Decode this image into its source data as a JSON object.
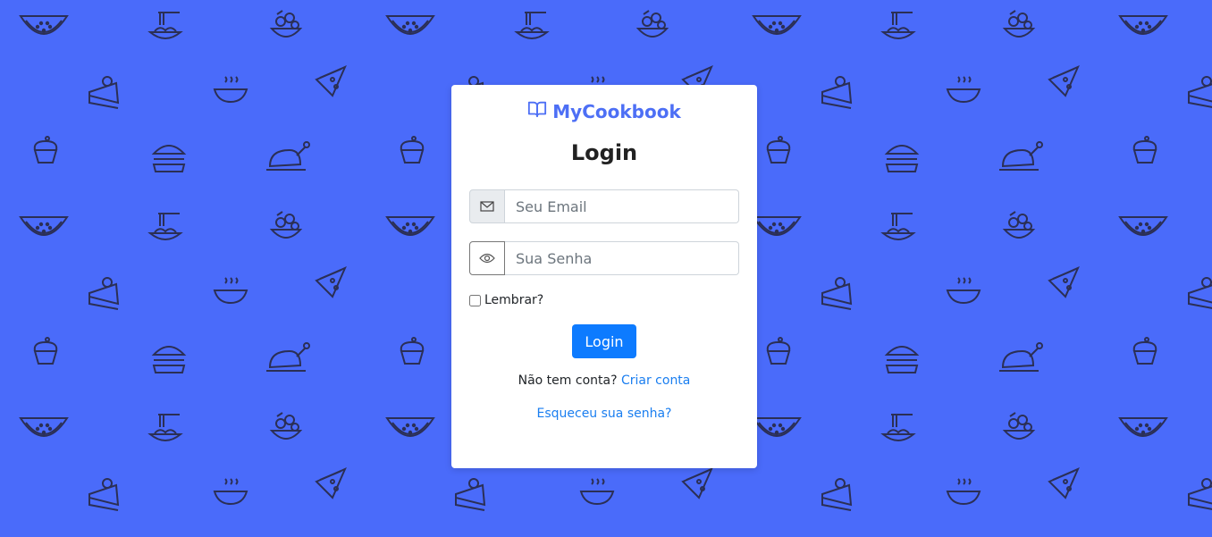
{
  "brand": {
    "name": "MyCookbook",
    "icon": "open-book-icon",
    "color": "#4d6ff5"
  },
  "form": {
    "title": "Login",
    "email_placeholder": "Seu Email",
    "email_icon": "envelope-icon",
    "password_placeholder": "Sua Senha",
    "password_icon": "eye-icon",
    "remember_label": "Lembrar?",
    "login_button": "Login"
  },
  "footer": {
    "no_account_text": "Não tem conta?",
    "create_account_link": "Criar conta",
    "forgot_password_link": "Esqueceu sua senha?"
  },
  "background": {
    "color": "#4a6bfa",
    "pattern_icons": [
      "watermelon-icon",
      "spaghetti-icon",
      "salad-icon",
      "cake-slice-icon",
      "soup-bowl-icon",
      "pizza-slice-icon",
      "cupcake-icon",
      "burger-icon",
      "roast-chicken-icon"
    ]
  },
  "colors": {
    "primary_button": "#0d7bff",
    "link": "#1a7ef0"
  }
}
